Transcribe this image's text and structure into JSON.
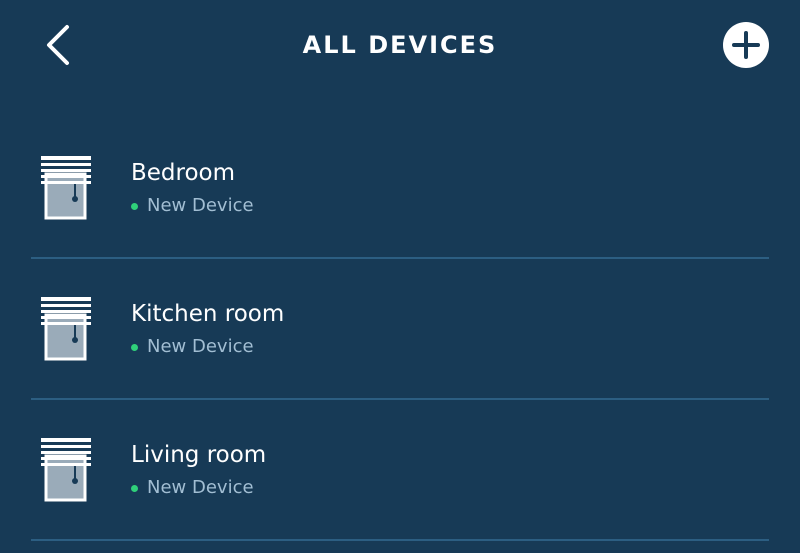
{
  "header": {
    "title": "ALL DEVICES",
    "back_icon": "chevron-left-icon",
    "add_icon": "plus-circle-icon"
  },
  "devices": [
    {
      "name": "Bedroom",
      "status": "New Device",
      "icon": "window-blinds-icon"
    },
    {
      "name": "Kitchen room",
      "status": "New Device",
      "icon": "window-blinds-icon"
    },
    {
      "name": "Living room",
      "status": "New Device",
      "icon": "window-blinds-icon"
    }
  ],
  "colors": {
    "background": "#173a56",
    "divider": "#2c5e82",
    "status_dot": "#2fd07a",
    "status_text": "#a2bed3",
    "text": "#ffffff"
  }
}
